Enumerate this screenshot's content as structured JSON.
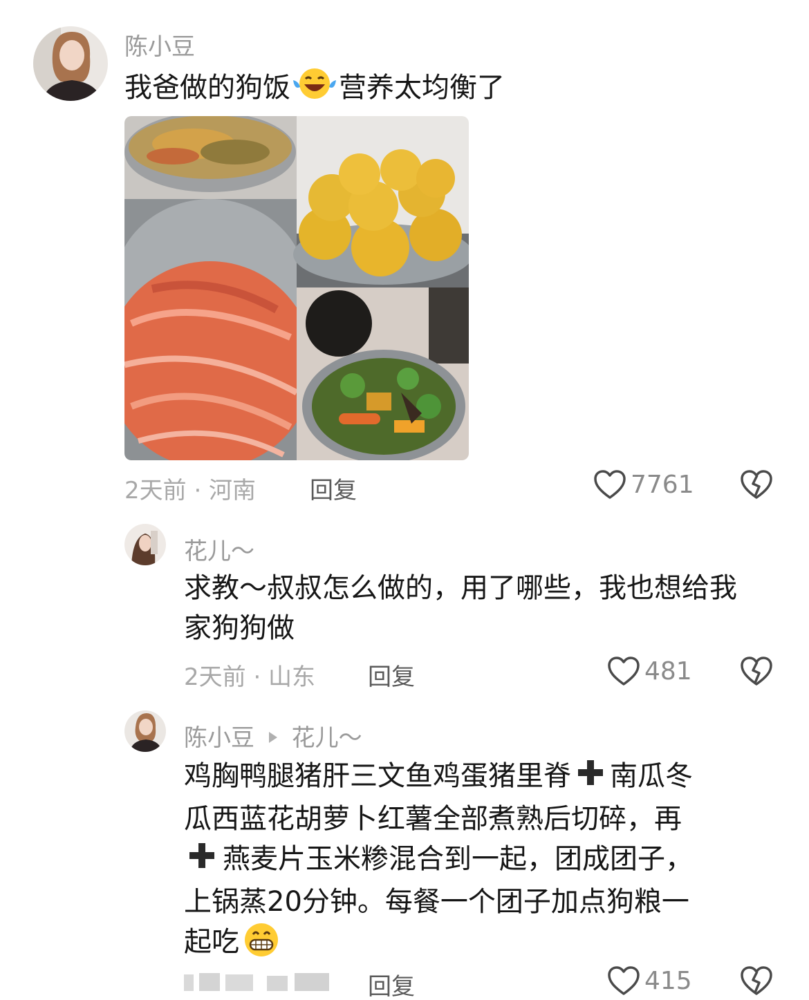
{
  "comments": [
    {
      "username": "陈小豆",
      "text_a": "我爸做的狗饭",
      "emoji_a": "crying-laughing-emoji",
      "text_b": "营养太均衡了",
      "meta": "2天前 · 河南",
      "reply_label": "回复",
      "likes": "7761"
    },
    {
      "username": "花儿～",
      "text": "求教～叔叔怎么做的，用了哪些，我也想给我家狗狗做",
      "meta": "2天前 · 山东",
      "reply_label": "回复",
      "likes": "481"
    },
    {
      "username": "陈小豆",
      "reply_to": "花儿～",
      "line1": "鸡胸鸭腿猪肝三文鱼鸡蛋猪里脊",
      "line1b": "南瓜冬",
      "line2": "瓜西蓝花胡萝卜红薯全部煮熟后切碎，再",
      "line3": "燕麦片玉米糁混合到一起，团成团子，",
      "line4": "上锅蒸20分钟。每餐一个团子加点狗粮一",
      "line5": "起吃",
      "emoji": "grinning-emoji",
      "reply_label": "回复",
      "likes": "415"
    }
  ],
  "icons": {
    "like": "heart-outline-icon",
    "dislike": "broken-heart-icon",
    "plus": "heavy-plus-icon",
    "reply_arrow": "triangle-right-icon"
  },
  "colors": {
    "username": "#9a9a9a",
    "text": "#161616",
    "meta": "#a8a8a8"
  }
}
